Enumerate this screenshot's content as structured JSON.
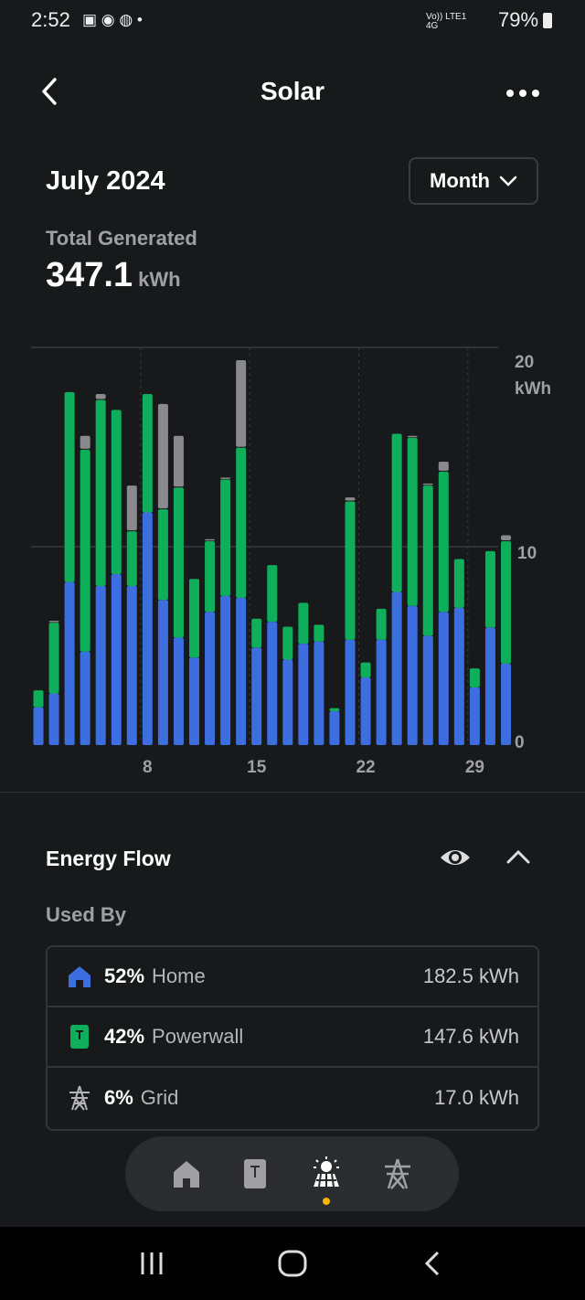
{
  "status_bar": {
    "time": "2:52",
    "network": "Vo)) LTE1 4G",
    "battery": "79%"
  },
  "header": {
    "title": "Solar",
    "back_icon": "chevron-left-icon",
    "more_icon": "more-horizontal-icon"
  },
  "period": {
    "label": "July 2024",
    "selector_value": "Month"
  },
  "total": {
    "label": "Total Generated",
    "value": "347.1",
    "unit": "kWh"
  },
  "chart_data": {
    "type": "bar",
    "stacked": true,
    "x": [
      1,
      2,
      3,
      4,
      5,
      6,
      7,
      8,
      9,
      10,
      11,
      12,
      13,
      14,
      15,
      16,
      17,
      18,
      19,
      20,
      21,
      22,
      23,
      24,
      25,
      26,
      27,
      28,
      29,
      30,
      31
    ],
    "x_tick_labels": [
      "8",
      "15",
      "22",
      "29"
    ],
    "y_tick_labels": [
      "0",
      "10",
      "20"
    ],
    "yunit": "kWh",
    "ylim": [
      0,
      20
    ],
    "grid": true,
    "series": [
      {
        "color": "#3d6ee0",
        "values": [
          1.9,
          2.6,
          8.2,
          4.7,
          8.0,
          8.6,
          8.0,
          11.7,
          7.3,
          5.4,
          4.4,
          6.7,
          7.5,
          7.4,
          4.9,
          6.2,
          4.3,
          5.1,
          5.2,
          1.7,
          5.3,
          3.4,
          5.3,
          7.7,
          7.0,
          5.5,
          6.7,
          6.9,
          2.9,
          5.9,
          4.1
        ]
      },
      {
        "color": "#0fae5a",
        "values": [
          0.9,
          3.6,
          9.6,
          10.2,
          9.4,
          8.3,
          2.8,
          6.0,
          4.6,
          7.6,
          4.0,
          3.6,
          5.9,
          7.6,
          1.5,
          2.9,
          1.7,
          2.1,
          0.9,
          0.2,
          7.0,
          0.8,
          1.6,
          8.0,
          8.5,
          7.6,
          7.1,
          2.5,
          1.0,
          3.9,
          6.2
        ]
      },
      {
        "color": "#8a8a8e",
        "values": [
          0,
          0.1,
          0,
          0.7,
          0.3,
          0,
          2.3,
          0,
          5.3,
          2.6,
          0,
          0.1,
          0.1,
          4.4,
          0,
          0,
          0,
          0,
          0,
          0,
          0.2,
          0,
          0,
          0,
          0.1,
          0.1,
          0.5,
          0,
          0,
          0,
          0.3
        ]
      }
    ]
  },
  "energy_flow": {
    "title": "Energy Flow",
    "used_by_label": "Used By",
    "items": [
      {
        "icon": "home-icon",
        "color": "#3d6ee0",
        "percent": "52%",
        "name": "Home",
        "value": "182.5 kWh"
      },
      {
        "icon": "powerwall-icon",
        "color": "#0fae5a",
        "percent": "42%",
        "name": "Powerwall",
        "value": "147.6 kWh"
      },
      {
        "icon": "grid-tower-icon",
        "color": "#b5b5b9",
        "percent": "6%",
        "name": "Grid",
        "value": "17.0 kWh"
      }
    ]
  },
  "bottom_nav": {
    "items": [
      "home-icon",
      "powerwall-icon",
      "solar-icon",
      "grid-tower-icon"
    ],
    "active": "solar-icon",
    "indicator_color": "#f5b400"
  }
}
